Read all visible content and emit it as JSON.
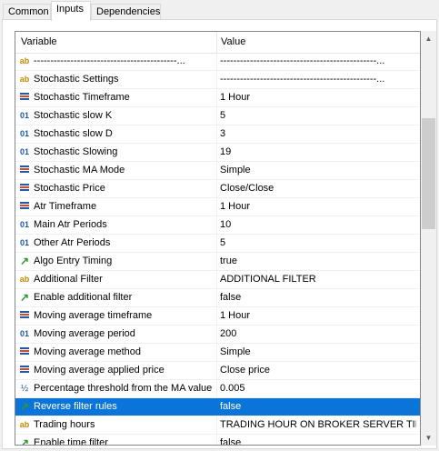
{
  "tabs": [
    {
      "label": "Common",
      "active": false
    },
    {
      "label": "Inputs",
      "active": true
    },
    {
      "label": "Dependencies",
      "active": false
    }
  ],
  "grid": {
    "columns": {
      "variable": "Variable",
      "value": "Value"
    },
    "rows": [
      {
        "icon": "ab",
        "label": "-------------------------------------------...",
        "value": "-----------------------------------------------..."
      },
      {
        "icon": "ab",
        "label": "Stochastic Settings",
        "value": "-----------------------------------------------..."
      },
      {
        "icon": "enum",
        "label": "Stochastic Timeframe",
        "value": "1 Hour"
      },
      {
        "icon": "01",
        "label": "Stochastic slow K",
        "value": "5"
      },
      {
        "icon": "01",
        "label": "Stochastic slow D",
        "value": "3"
      },
      {
        "icon": "01",
        "label": "Stochastic Slowing",
        "value": "19"
      },
      {
        "icon": "enum",
        "label": "Stochastic MA Mode",
        "value": "Simple"
      },
      {
        "icon": "enum",
        "label": "Stochastic Price",
        "value": "Close/Close"
      },
      {
        "icon": "enum",
        "label": "Atr Timeframe",
        "value": "1 Hour"
      },
      {
        "icon": "01",
        "label": "Main Atr Periods",
        "value": "10"
      },
      {
        "icon": "01",
        "label": "Other Atr Periods",
        "value": "5"
      },
      {
        "icon": "bool",
        "label": "Algo Entry Timing",
        "value": "true"
      },
      {
        "icon": "ab",
        "label": "Additional Filter",
        "value": "ADDITIONAL FILTER"
      },
      {
        "icon": "bool",
        "label": "Enable additional filter",
        "value": "false"
      },
      {
        "icon": "enum",
        "label": "Moving average timeframe",
        "value": "1 Hour"
      },
      {
        "icon": "01",
        "label": "Moving average period",
        "value": "200"
      },
      {
        "icon": "enum",
        "label": "Moving average method",
        "value": "Simple"
      },
      {
        "icon": "enum",
        "label": "Moving average applied price",
        "value": "Close price"
      },
      {
        "icon": "half",
        "label": "Percentage threshold from the MA value",
        "value": "0.005"
      },
      {
        "icon": "bool",
        "label": "Reverse filter rules",
        "value": "false",
        "selected": true
      },
      {
        "icon": "ab",
        "label": "Trading hours",
        "value": "TRADING HOUR ON BROKER SERVER TIME"
      },
      {
        "icon": "bool",
        "label": "Enable time filter",
        "value": "false"
      }
    ]
  },
  "scrollbar": {
    "up": "▲",
    "down": "▼"
  },
  "colors": {
    "selection": "#0a74d8",
    "accent_green": "#2c9a2c",
    "accent_blue": "#1e5aa8",
    "accent_gold": "#c48a00"
  }
}
